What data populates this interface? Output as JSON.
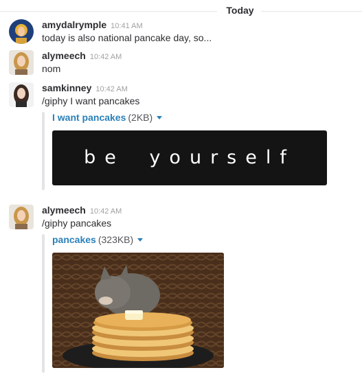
{
  "day_divider": {
    "label": "Today"
  },
  "messages": [
    {
      "username": "amydalrymple",
      "time": "10:41 AM",
      "text": "today is also national pancake day, so..."
    },
    {
      "username": "alymeech",
      "time": "10:42 AM",
      "text": "nom"
    },
    {
      "username": "samkinney",
      "time": "10:42 AM",
      "text": "/giphy I want pancakes",
      "attachment": {
        "title": "I want pancakes",
        "size": "(2KB)",
        "gif_text": "be yourself"
      }
    },
    {
      "username": "alymeech",
      "time": "10:42 AM",
      "text": "/giphy pancakes",
      "attachment": {
        "title": "pancakes",
        "size": "(323KB)"
      }
    }
  ],
  "colors": {
    "link": "#2a80b9",
    "text": "#2c2d30",
    "timestamp": "#a0a0a2",
    "attachment_bar": "#e3e4e6"
  }
}
